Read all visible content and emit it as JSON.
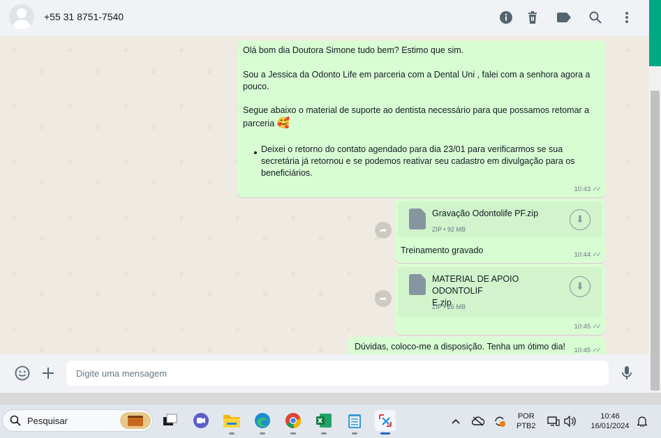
{
  "header": {
    "contact_name": "+55 31 8751-7540",
    "icons": [
      "info-icon",
      "trash-icon",
      "label-icon",
      "search-icon",
      "menu-dots-icon"
    ]
  },
  "messages": {
    "m1": {
      "line1": "Olá bom dia Doutora Simone tudo bem? Estimo que sim.",
      "line2": "Sou a Jessica da Odonto Life em parceria com a Dental Uni , falei com a senhora agora a",
      "line3": "pouco.",
      "line4": "Segue abaixo o material de suporte ao dentista necessário para que possamos retomar a",
      "line5": "parceria",
      "emoji": "🥰",
      "bullet1": "Deixei o retorno do contato agendado para dia 23/01 para verificarmos se sua",
      "bullet2": "secretária já retornou e se podemos reativar seu cadastro em divulgação para os",
      "bullet3": "beneficiários.",
      "time": "10:43"
    },
    "m2": {
      "file_name": "Gravação Odontolife PF.zip",
      "file_meta": "ZIP • 92 MB",
      "caption": "Treinamento gravado",
      "time": "10:44"
    },
    "m3": {
      "file_name_1": "MATERIAL DE APOIO ODONTOLIF",
      "file_name_2": "E.zip",
      "file_meta": "ZIP • 26 MB",
      "time": "10:45"
    },
    "m4": {
      "text": "Dúvidas, coloco-me a disposição. Tenha um ótimo dia!",
      "time": "10:45"
    }
  },
  "composer": {
    "placeholder": "Digite uma mensagem"
  },
  "taskbar": {
    "search_label": "Pesquisar",
    "lang_1": "POR",
    "lang_2": "PTB2",
    "clock_time": "10:46",
    "clock_date": "16/01/2024"
  },
  "colors": {
    "bubble_out": "#d9fdd3",
    "chat_bg": "#efeae2",
    "accent": "#00a884"
  }
}
